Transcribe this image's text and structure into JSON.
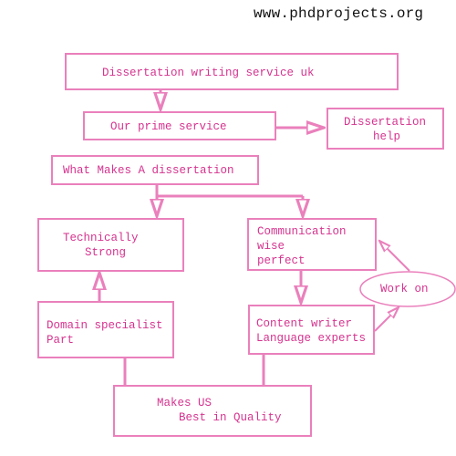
{
  "header": {
    "website": "www.phdprojects.org"
  },
  "colors": {
    "stroke": "#ea80bc",
    "text": "#d6338f"
  },
  "nodes": {
    "service_uk": {
      "label": "Dissertation writing service uk"
    },
    "prime_service": {
      "label": "Our prime service"
    },
    "dissertation_help": {
      "line1": "Dissertation",
      "line2": "help"
    },
    "what_makes": {
      "label": "What Makes A dissertation"
    },
    "technically_strong": {
      "line1": "Technically",
      "line2": "Strong"
    },
    "communication": {
      "line1": "Communication",
      "line2": "wise",
      "line3": "perfect"
    },
    "domain_specialist": {
      "line1": "Domain specialist",
      "line2": "Part"
    },
    "content_writer": {
      "line1": "Content writer",
      "line2": "Language experts"
    },
    "work_on": {
      "label": "Work on"
    },
    "makes_us": {
      "line1": "Makes US",
      "line2": "Best in Quality"
    }
  },
  "edges": [
    {
      "from": "service_uk",
      "to": "prime_service"
    },
    {
      "from": "prime_service",
      "to": "dissertation_help"
    },
    {
      "from": "what_makes",
      "to": "technically_strong"
    },
    {
      "from": "what_makes",
      "to": "communication"
    },
    {
      "from": "domain_specialist",
      "to": "technically_strong"
    },
    {
      "from": "communication",
      "to": "content_writer"
    },
    {
      "from": "content_writer",
      "to": "work_on"
    },
    {
      "from": "work_on",
      "to": "communication"
    },
    {
      "from": "domain_specialist",
      "to": "makes_us"
    },
    {
      "from": "content_writer",
      "to": "makes_us"
    }
  ]
}
